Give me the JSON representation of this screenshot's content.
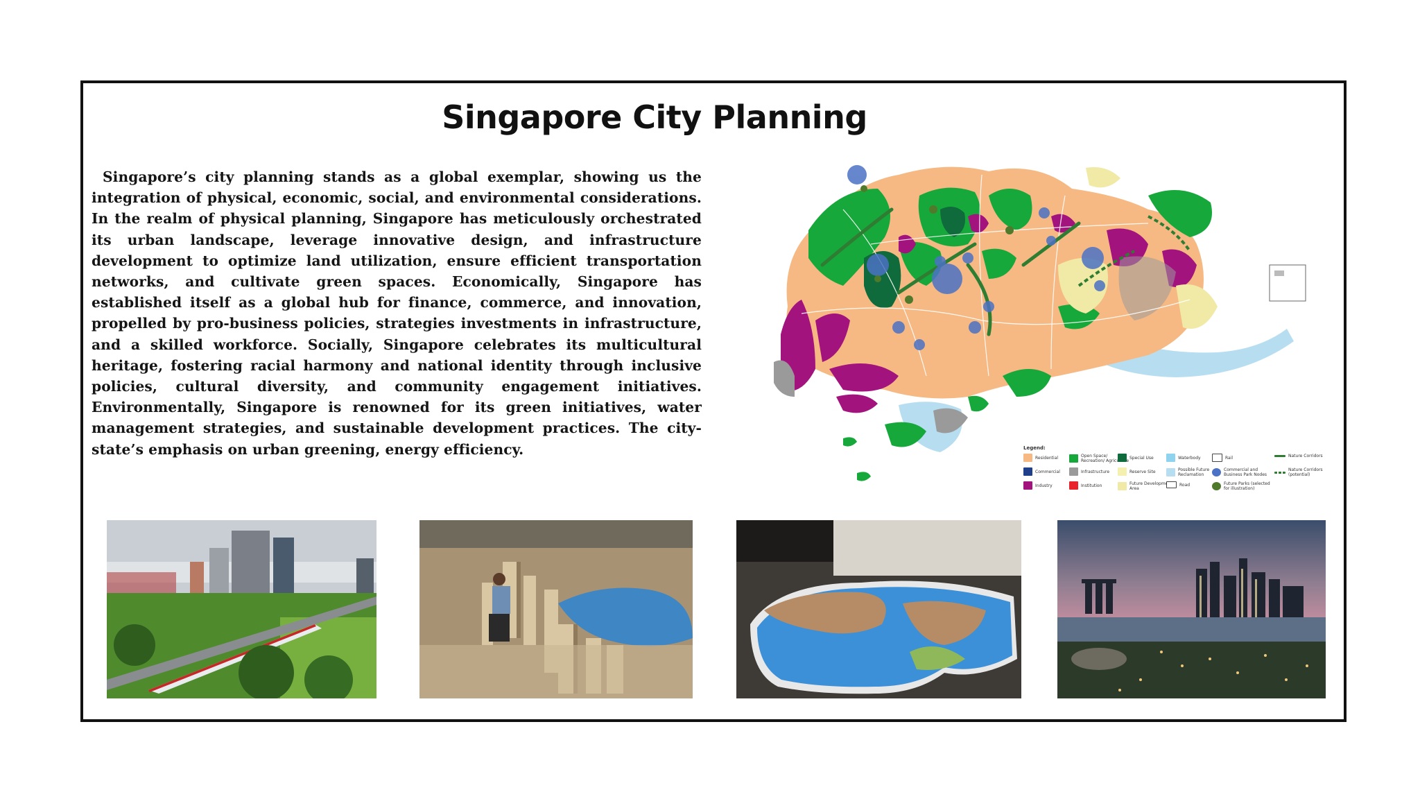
{
  "title": "Singapore City Planning",
  "body_text": "Singapore’s city planning stands as a global exemplar, showing us the integration of physical, economic, social, and environmental considerations.  In the realm of physical planning, Singapore has meticulously orchestrated its urban landscape, leverage innovative design, and infrastructure development to optimize land utilization, ensure efficient transportation networks, and cultivate green spaces. Economically, Singapore has established itself as a global hub for finance, commerce, and innovation, propelled by pro-business policies, strategies investments in infrastructure, and a skilled workforce. Socially, Singapore celebrates its multicultural heritage, fostering racial harmony and national identity through inclusive policies, cultural diversity, and community engagement initiatives. Environmentally, Singapore is renowned for its green initiatives, water management strategies, and sustainable development practices. The city-state’s emphasis on urban greening, energy efficiency.",
  "legend": {
    "title": "Legend:",
    "items": [
      {
        "label": "Residential",
        "color": "#f6b983"
      },
      {
        "label": "Commercial",
        "color": "#1f3f8a"
      },
      {
        "label": "Industry",
        "color": "#a3137e"
      },
      {
        "label": "Open Space/ Recreation/ Agriculture",
        "color": "#16a83a"
      },
      {
        "label": "Infrastructure",
        "color": "#9a9a9a"
      },
      {
        "label": "Institution",
        "color": "#e8232a"
      },
      {
        "label": "Special Use",
        "color": "#0f6b3c"
      },
      {
        "label": "Reserve Site",
        "color": "#f3f0b0"
      },
      {
        "label": "Future Development Area",
        "color": "#f1e9a6"
      },
      {
        "label": "Waterbody",
        "color": "#8fd3ef"
      },
      {
        "label": "Possible Future Reclamation",
        "color": "#b7def0"
      },
      {
        "label": "Road",
        "color": "#ffffff"
      },
      {
        "label": "Rail",
        "color": "#ffffff"
      },
      {
        "label": "Commercial and Business Park Nodes",
        "color": "#4b72c4"
      },
      {
        "label": "Future Parks (selected for illustration)",
        "color": "#4f7a2c"
      },
      {
        "label": "Nature Corridors",
        "color": "#2e7d32"
      },
      {
        "label": "Nature Corridors (potential)",
        "color": "#2e7d32"
      }
    ]
  },
  "photos": [
    {
      "name": "mrt-train-photo"
    },
    {
      "name": "city-model-worker-photo"
    },
    {
      "name": "city-gallery-model-photo"
    },
    {
      "name": "marina-bay-night-photo"
    }
  ]
}
